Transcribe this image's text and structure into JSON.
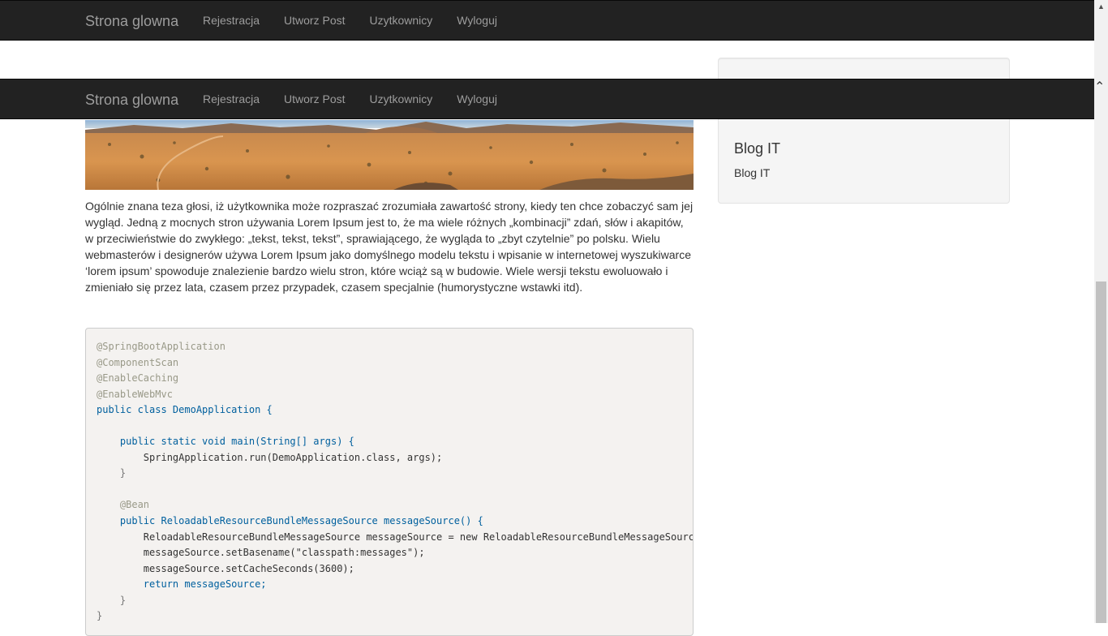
{
  "nav": {
    "brand": "Strona glowna",
    "links": [
      "Rejestracja",
      "Utworz Post",
      "Uzytkownicy",
      "Wyloguj"
    ]
  },
  "sidebar": {
    "title": "Blog IT",
    "text": "Blog IT"
  },
  "article": {
    "text": "Ogólnie znana teza głosi, iż użytkownika może rozpraszać zrozumiała zawartość strony, kiedy ten chce zobaczyć sam jej wygląd. Jedną z mocnych stron używania Lorem Ipsum jest to, że ma wiele różnych „kombinacji” zdań, słów i akapitów, w przeciwieństwie do zwykłego: „tekst, tekst, tekst”, sprawiającego, że wygląda to „zbyt czytelnie” po polsku. Wielu webmasterów i designerów używa Lorem Ipsum jako domyślnego modelu tekstu i wpisanie w internetowej wyszukiwarce ‘lorem ipsum’ spowoduje znalezienie bardzo wielu stron, które wciąż są w budowie. Wiele wersji tekstu ewoluowało i zmieniało się przez lata, czasem przez przypadek, czasem specjalnie (humorystyczne wstawki itd)."
  },
  "code": {
    "lines": [
      "@SpringBootApplication",
      "@ComponentScan",
      "@EnableCaching",
      "@EnableWebMvc",
      "public class DemoApplication {",
      "",
      "    public static void main(String[] args) {",
      "        SpringApplication.run(DemoApplication.class, args);",
      "    }",
      "",
      "    @Bean",
      "    public ReloadableResourceBundleMessageSource messageSource() {",
      "        ReloadableResourceBundleMessageSource messageSource = new ReloadableResourceBundleMessageSource()",
      "        messageSource.setBasename(\"classpath:messages\");",
      "        messageSource.setCacheSeconds(3600);",
      "        return messageSource;",
      "    }",
      "}"
    ]
  },
  "colors": {
    "navbar": "#222222",
    "nav_text": "#9d9d9d",
    "code_bg": "#f4f2f0"
  },
  "icons": {
    "scroll_up": "chevron-up-icon"
  }
}
